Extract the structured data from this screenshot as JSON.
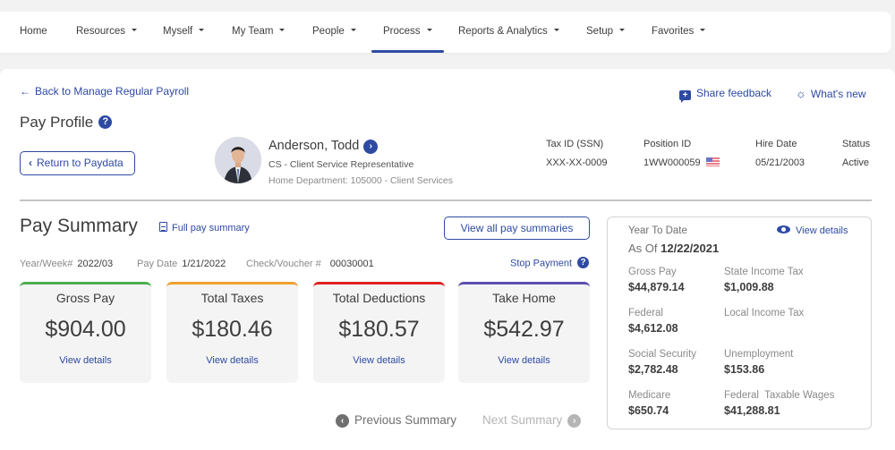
{
  "nav": {
    "items": [
      {
        "label": "Home",
        "dropdown": false
      },
      {
        "label": "Resources",
        "dropdown": true
      },
      {
        "label": "Myself",
        "dropdown": true
      },
      {
        "label": "My Team",
        "dropdown": true
      },
      {
        "label": "People",
        "dropdown": true
      },
      {
        "label": "Process",
        "dropdown": true,
        "active": true
      },
      {
        "label": "Reports & Analytics",
        "dropdown": true
      },
      {
        "label": "Setup",
        "dropdown": true
      },
      {
        "label": "Favorites",
        "dropdown": true
      }
    ]
  },
  "header": {
    "back_link": "Back to Manage Regular Payroll",
    "title": "Pay Profile",
    "return_button": "Return to Paydata",
    "share_feedback": "Share feedback",
    "whats_new": "What's new"
  },
  "employee": {
    "name": "Anderson, Todd",
    "role": "CS - Client Service Representative",
    "department": "Home Department: 105000 - Client Services",
    "tax_id_label": "Tax ID (SSN)",
    "tax_id": "XXX-XX-0009",
    "position_id_label": "Position ID",
    "position_id": "1WW000059",
    "hire_date_label": "Hire Date",
    "hire_date": "05/21/2003",
    "status_label": "Status",
    "status": "Active"
  },
  "pay_summary": {
    "title": "Pay Summary",
    "full_link": "Full pay summary",
    "view_all": "View all pay summaries",
    "year_week_label": "Year/Week#",
    "year_week": "2022/03",
    "pay_date_label": "Pay Date",
    "pay_date": "1/21/2022",
    "check_label": "Check/Voucher #",
    "check": "00030001",
    "stop_payment": "Stop Payment",
    "cards": [
      {
        "label": "Gross Pay",
        "value": "$904.00",
        "link": "View details",
        "color": "#4caf50"
      },
      {
        "label": "Total Taxes",
        "value": "$180.46",
        "link": "View details",
        "color": "#f0a030"
      },
      {
        "label": "Total Deductions",
        "value": "$180.57",
        "link": "View details",
        "color": "#e02020"
      },
      {
        "label": "Take Home",
        "value": "$542.97",
        "link": "View details",
        "color": "#5b4fb0"
      }
    ],
    "previous": "Previous Summary",
    "next": "Next Summary"
  },
  "ytd": {
    "title": "Year To Date",
    "as_of_label": "As Of",
    "as_of": "12/22/2021",
    "view_details": "View details",
    "items": [
      {
        "label": "Gross Pay",
        "value": "$44,879.14"
      },
      {
        "label": "State Income Tax",
        "value": "$1,009.88"
      },
      {
        "label": "Federal",
        "value": "$4,612.08"
      },
      {
        "label": "Local Income Tax",
        "value": ""
      },
      {
        "label": "Social Security",
        "value": "$2,782.48"
      },
      {
        "label": "Unemployment",
        "value": "$153.86"
      },
      {
        "label": "Medicare",
        "value": "$650.74"
      },
      {
        "label": "Federal  Taxable Wages",
        "value": "$41,288.81"
      }
    ]
  },
  "colors": {
    "accent": "#2e4aa3"
  }
}
